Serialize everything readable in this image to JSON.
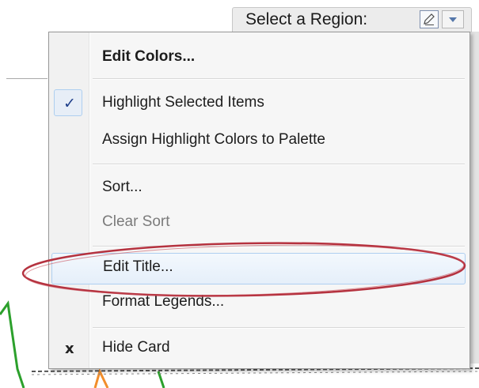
{
  "region_selector": {
    "label": "Select a Region:",
    "edit_icon": "pencil-icon",
    "dropdown_icon": "chevron-down-icon"
  },
  "menu": {
    "items": [
      {
        "label": "Edit Colors...",
        "bold": true,
        "checked": false,
        "enabled": true
      },
      {
        "label": "Highlight Selected Items",
        "bold": false,
        "checked": true,
        "enabled": true
      },
      {
        "label": "Assign Highlight Colors to Palette",
        "bold": false,
        "checked": false,
        "enabled": true
      },
      {
        "label": "Sort...",
        "bold": false,
        "checked": false,
        "enabled": true
      },
      {
        "label": "Clear Sort",
        "bold": false,
        "checked": false,
        "enabled": false
      },
      {
        "label": "Edit Title...",
        "bold": false,
        "checked": false,
        "enabled": true,
        "highlighted": true
      },
      {
        "label": "Format Legends...",
        "bold": false,
        "checked": false,
        "enabled": true
      },
      {
        "label": "Hide Card",
        "bold": false,
        "checked": false,
        "enabled": true,
        "icon": "x-icon"
      }
    ]
  },
  "glyphs": {
    "check": "✓",
    "x": "x"
  },
  "colors": {
    "highlight_border": "#aecff0",
    "annotation_ellipse": "#b5323f",
    "chart_line_green": "#2ca02c",
    "chart_line_orange": "#f28e2b"
  }
}
